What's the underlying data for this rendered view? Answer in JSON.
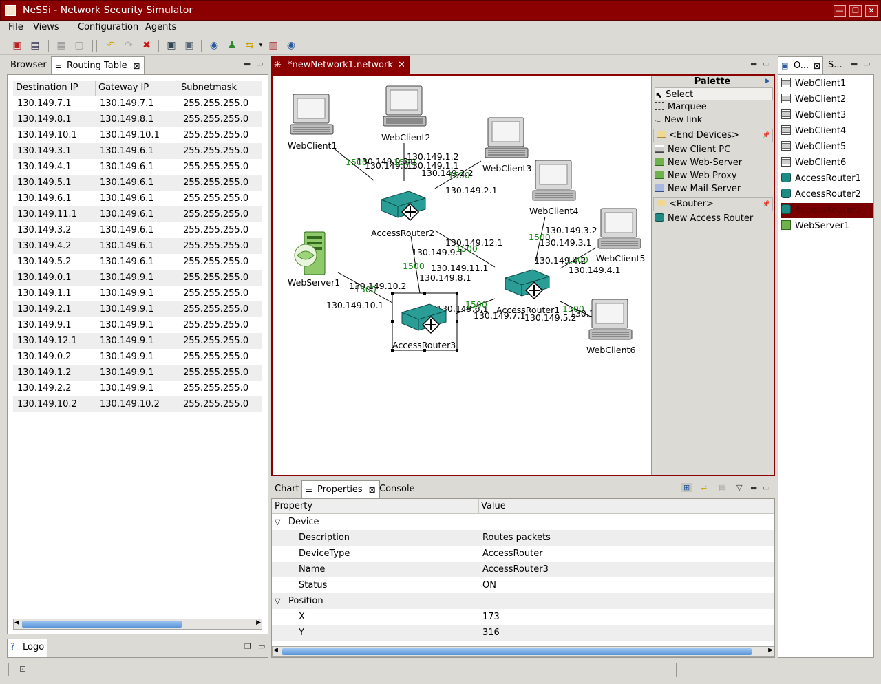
{
  "window": {
    "title": "NeSSi - Network Security Simulator"
  },
  "menu": [
    "File",
    "Views",
    "Configuration",
    "Agents"
  ],
  "left_panel": {
    "tabs": [
      "Browser",
      "Routing Table"
    ],
    "columns": [
      "Destination IP",
      "Gateway IP",
      "Subnetmask"
    ],
    "rows": [
      [
        "130.149.7.1",
        "130.149.7.1",
        "255.255.255.0"
      ],
      [
        "130.149.8.1",
        "130.149.8.1",
        "255.255.255.0"
      ],
      [
        "130.149.10.1",
        "130.149.10.1",
        "255.255.255.0"
      ],
      [
        "130.149.3.1",
        "130.149.6.1",
        "255.255.255.0"
      ],
      [
        "130.149.4.1",
        "130.149.6.1",
        "255.255.255.0"
      ],
      [
        "130.149.5.1",
        "130.149.6.1",
        "255.255.255.0"
      ],
      [
        "130.149.6.1",
        "130.149.6.1",
        "255.255.255.0"
      ],
      [
        "130.149.11.1",
        "130.149.6.1",
        "255.255.255.0"
      ],
      [
        "130.149.3.2",
        "130.149.6.1",
        "255.255.255.0"
      ],
      [
        "130.149.4.2",
        "130.149.6.1",
        "255.255.255.0"
      ],
      [
        "130.149.5.2",
        "130.149.6.1",
        "255.255.255.0"
      ],
      [
        "130.149.0.1",
        "130.149.9.1",
        "255.255.255.0"
      ],
      [
        "130.149.1.1",
        "130.149.9.1",
        "255.255.255.0"
      ],
      [
        "130.149.2.1",
        "130.149.9.1",
        "255.255.255.0"
      ],
      [
        "130.149.9.1",
        "130.149.9.1",
        "255.255.255.0"
      ],
      [
        "130.149.12.1",
        "130.149.9.1",
        "255.255.255.0"
      ],
      [
        "130.149.0.2",
        "130.149.9.1",
        "255.255.255.0"
      ],
      [
        "130.149.1.2",
        "130.149.9.1",
        "255.255.255.0"
      ],
      [
        "130.149.2.2",
        "130.149.9.1",
        "255.255.255.0"
      ],
      [
        "130.149.10.2",
        "130.149.10.2",
        "255.255.255.0"
      ]
    ]
  },
  "logo_panel": {
    "tab": "Logo"
  },
  "editor": {
    "tab": "*newNetwork1.network",
    "devices": {
      "wc1": "WebClient1",
      "wc2": "WebClient2",
      "wc3": "WebClient3",
      "wc4": "WebClient4",
      "wc5": "WebClient5",
      "wc6": "WebClient6",
      "ar1": "AccessRouter1",
      "ar2": "AccessRouter2",
      "ar3": "AccessRouter3",
      "ws1": "WebServer1"
    },
    "link_labels": [
      "130.149.0.2",
      "1500",
      "130.149.0.1",
      "1500",
      "130.149.1.2",
      "130.149.1.1",
      "130.149.2.2",
      "1500",
      "130.149.2.1",
      "130.149.12.1",
      "1500",
      "130.149.9.1",
      "1500",
      "130.149.11.1",
      "130.149.8.1",
      "130.149.3.2",
      "1500",
      "130.149.3.1",
      "130.149.4.2",
      "1500",
      "130.149.4.1",
      "130.149.10.2",
      "1500",
      "130.149.10.1",
      "130.149.6.1",
      "1500",
      "130.149.7.1",
      "130.149.5.2",
      "1500",
      "130.149.5.1"
    ]
  },
  "palette": {
    "title": "Palette",
    "tools": [
      "Select",
      "Marquee",
      "New link"
    ],
    "groups": [
      {
        "name": "<End Devices>",
        "items": [
          "New Client PC",
          "New Web-Server",
          "New Web Proxy",
          "New Mail-Server"
        ]
      },
      {
        "name": "<Router>",
        "items": [
          "New Access Router"
        ]
      }
    ]
  },
  "outline": {
    "tabs": [
      "O...",
      "S..."
    ],
    "items": [
      "WebClient1",
      "WebClient2",
      "WebClient3",
      "WebClient4",
      "WebClient5",
      "WebClient6",
      "AccessRouter1",
      "AccessRouter2",
      "AccessRouter3",
      "WebServer1"
    ],
    "selected": "AccessRouter3"
  },
  "bottom_panel": {
    "tabs": [
      "Chart",
      "Properties",
      "Console"
    ],
    "columns": [
      "Property",
      "Value"
    ],
    "groups": [
      {
        "name": "Device",
        "rows": [
          [
            "Description",
            "Routes packets"
          ],
          [
            "DeviceType",
            "AccessRouter"
          ],
          [
            "Name",
            "AccessRouter3"
          ],
          [
            "Status",
            "ON"
          ]
        ]
      },
      {
        "name": "Position",
        "rows": [
          [
            "X",
            "173"
          ],
          [
            "Y",
            "316"
          ]
        ]
      }
    ]
  },
  "colors": {
    "title_bar": "#8b0000",
    "selection": "#7a0000",
    "bandwidth_label": "#1a8a1a",
    "accent_blue": "#5894d6"
  }
}
